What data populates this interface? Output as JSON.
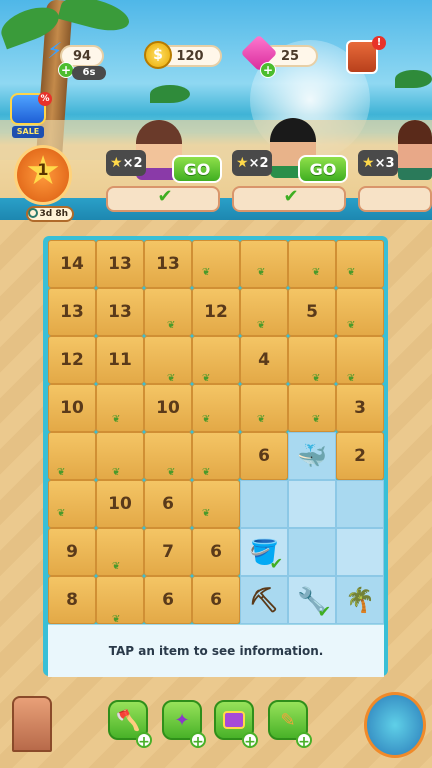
{
  "top_bar": {
    "energy": {
      "value": "94",
      "timer": "6s"
    },
    "coins": {
      "value": "120"
    },
    "gems": {
      "value": "25"
    }
  },
  "sale": {
    "label": "SALE",
    "discount": "%"
  },
  "level": {
    "number": "1",
    "timer": "3d 8h"
  },
  "tasks": [
    {
      "stars": "2",
      "button": "GO"
    },
    {
      "stars": "2",
      "button": "GO"
    },
    {
      "stars": "3"
    }
  ],
  "board": {
    "rows": [
      [
        "14",
        "13",
        "13",
        "",
        "",
        "",
        ""
      ],
      [
        "13",
        "13",
        "",
        "12",
        "",
        "5",
        ""
      ],
      [
        "12",
        "11",
        "",
        "",
        "4",
        "",
        ""
      ],
      [
        "10",
        "",
        "10",
        "",
        "",
        "",
        "3"
      ],
      [
        "",
        "",
        "",
        "",
        "6",
        "",
        "2"
      ],
      [
        "",
        "10",
        "6",
        "",
        "",
        "",
        ""
      ],
      [
        "9",
        "",
        "7",
        "6",
        "",
        "",
        ""
      ],
      [
        "8",
        "",
        "6",
        "6",
        "",
        "",
        ""
      ]
    ]
  },
  "info": {
    "message": "TAP an item to see information."
  },
  "notification_badge": "!"
}
